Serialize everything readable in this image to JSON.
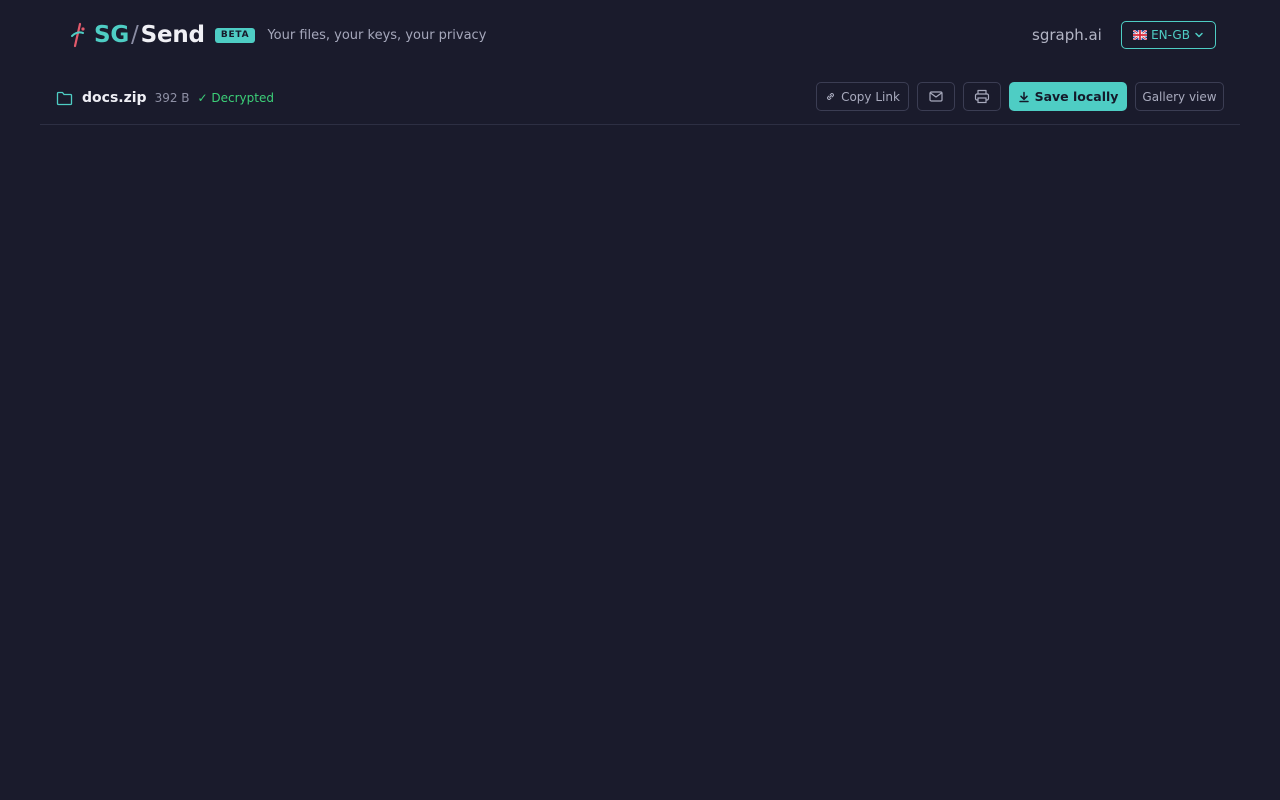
{
  "brand": {
    "sg": "SG",
    "slash": "/",
    "send": "Send",
    "badge": "BETA",
    "tagline": "Your files, your keys, your privacy"
  },
  "nav": {
    "site_link": "sgraph.ai",
    "language": "EN-GB"
  },
  "file": {
    "name": "docs.zip",
    "size": "392 B",
    "status": "✓ Decrypted"
  },
  "toolbar": {
    "copy_link_label": "Copy Link",
    "save_label": "Save locally",
    "gallery_label": "Gallery view"
  },
  "colors": {
    "background": "#1a1b2c",
    "accent": "#4ecdc4",
    "success": "#3ccf78"
  },
  "icons": {
    "logo": "sg-send-logo-icon",
    "flag": "uk-flag-icon",
    "folder": "folder-icon",
    "link": "link-icon",
    "email": "email-icon",
    "print": "printer-icon",
    "download": "download-icon"
  }
}
